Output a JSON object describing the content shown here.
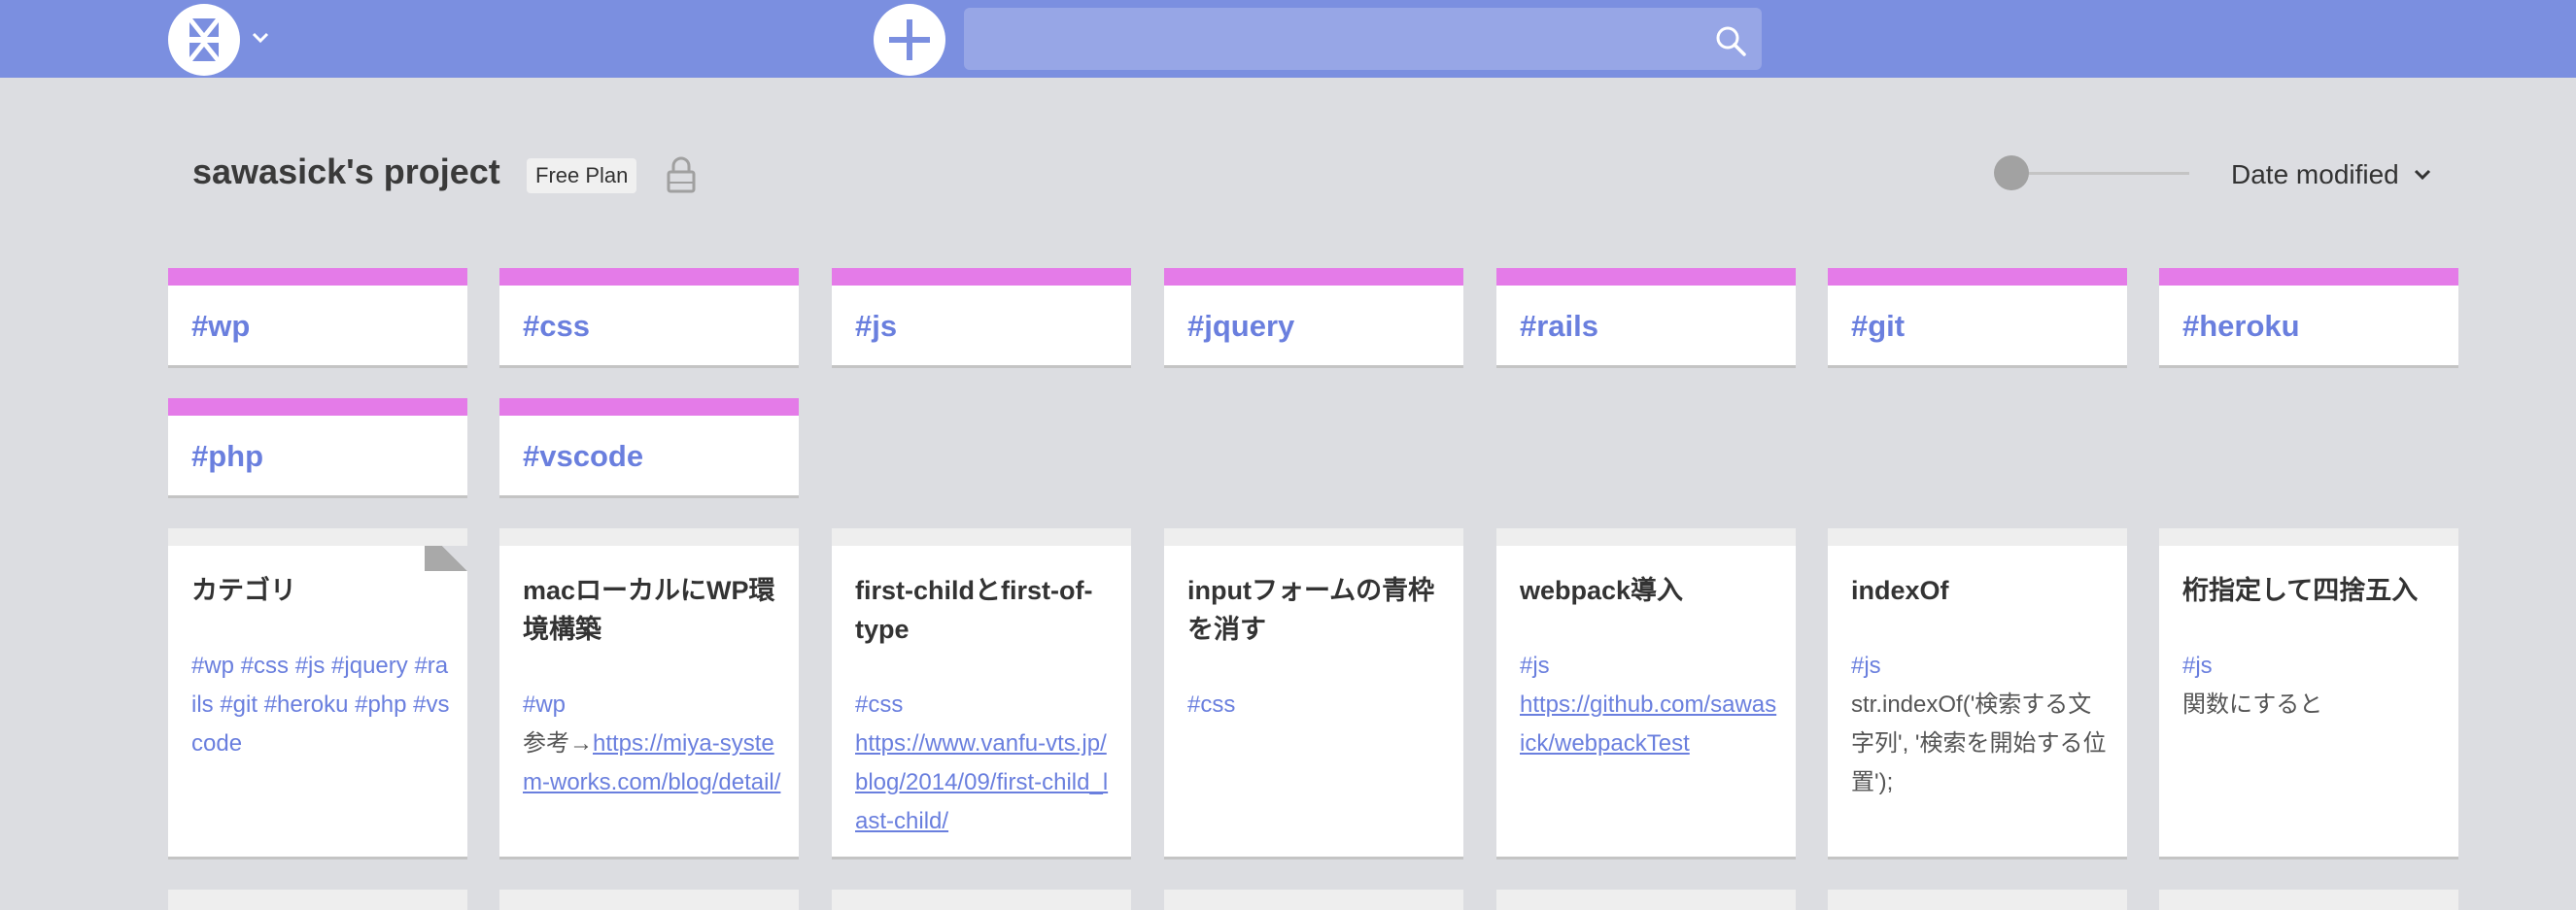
{
  "header": {
    "search_placeholder": ""
  },
  "project": {
    "title": "sawasick's project",
    "plan": "Free Plan",
    "sort_label": "Date modified"
  },
  "tags": [
    "#wp",
    "#css",
    "#js",
    "#jquery",
    "#rails",
    "#git",
    "#heroku",
    "#php",
    "#vscode"
  ],
  "pages": [
    {
      "title": "カテゴリ",
      "tags": "#wp #css #js #jquery #rails #git #heroku #php #vscode"
    },
    {
      "title": "macローカルにWP環境構築",
      "tag": "#wp",
      "prefix": "参考→",
      "link": "https://miya-system-works.com/blog/detail/"
    },
    {
      "title": "first-childとfirst-of-type",
      "tag": "#css",
      "link": "https://www.vanfu-vts.jp/blog/2014/09/first-child_last-child/"
    },
    {
      "title": "inputフォームの青枠を消す",
      "tag": "#css"
    },
    {
      "title": "webpack導入",
      "tag": "#js",
      "link": "https://github.com/sawasick/webpackTest"
    },
    {
      "title": "indexOf",
      "tag": "#js",
      "text": "str.indexOf('検索する文字列', '検索を開始する位置');"
    },
    {
      "title": "桁指定して四捨五入",
      "tag": "#js",
      "text": "関数にすると"
    }
  ],
  "colors": {
    "header": "#7b8fe0",
    "tag_accent": "#e47be8",
    "link": "#6a7fde",
    "background": "#dcdde1"
  },
  "icons": [
    "logo-icon",
    "chevron-down-icon",
    "plus-icon",
    "search-icon",
    "lock-icon"
  ]
}
